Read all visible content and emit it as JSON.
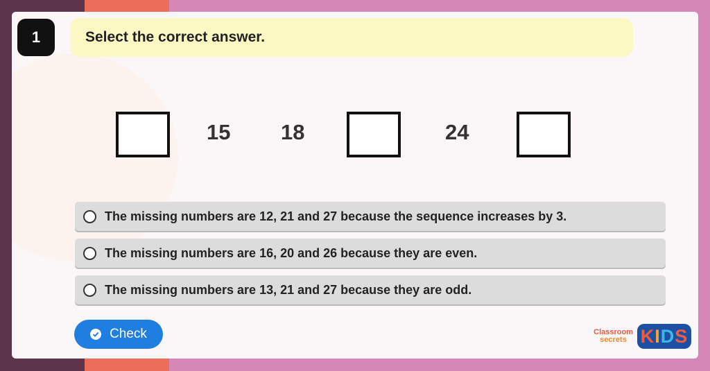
{
  "question": {
    "number": "1",
    "instruction": "Select the correct answer."
  },
  "sequence": {
    "n1": "15",
    "n2": "18",
    "n3": "24"
  },
  "options": [
    {
      "label": "The missing numbers are 12, 21 and 27 because the sequence increases by 3."
    },
    {
      "label": "The missing numbers are 16, 20 and 26 because they are even."
    },
    {
      "label": "The missing numbers are 13, 21 and 27 because they are odd."
    }
  ],
  "check_button": {
    "label": "Check"
  },
  "logo": {
    "top": "Classroom",
    "bottom": "secrets",
    "kids": [
      "K",
      "I",
      "D",
      "S"
    ]
  },
  "colors": {
    "accent": "#1f7fe0",
    "instruction_bg": "#fbf8c4",
    "option_bg": "#dcdcdc"
  }
}
